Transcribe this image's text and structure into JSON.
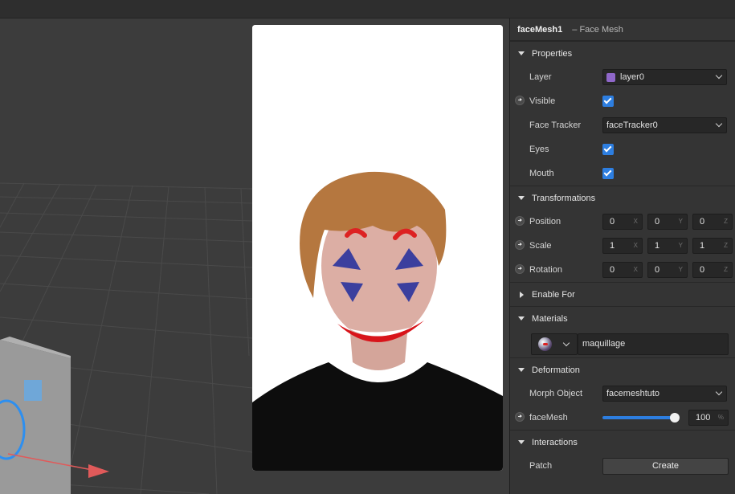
{
  "inspector": {
    "object_name": "faceMesh1",
    "object_type": "– Face Mesh",
    "sections": {
      "properties": "Properties",
      "transformations": "Transformations",
      "enable_for": "Enable For",
      "materials": "Materials",
      "deformation": "Deformation",
      "interactions": "Interactions"
    },
    "properties": {
      "layer_label": "Layer",
      "layer_value": "layer0",
      "layer_color": "#8f67c9",
      "visible_label": "Visible",
      "visible_checked": true,
      "face_tracker_label": "Face Tracker",
      "face_tracker_value": "faceTracker0",
      "eyes_label": "Eyes",
      "eyes_checked": true,
      "mouth_label": "Mouth",
      "mouth_checked": true
    },
    "transformations": {
      "position_label": "Position",
      "position": [
        "0",
        "0",
        "0"
      ],
      "scale_label": "Scale",
      "scale": [
        "1",
        "1",
        "1"
      ],
      "rotation_label": "Rotation",
      "rotation": [
        "0",
        "0",
        "0"
      ],
      "axes": [
        "X",
        "Y",
        "Z"
      ]
    },
    "materials": {
      "material_name": "maquillage",
      "material_icon": "material-sphere-icon"
    },
    "deformation": {
      "morph_object_label": "Morph Object",
      "morph_object_value": "facemeshtuto",
      "facemesh_label": "faceMesh",
      "facemesh_value": "100",
      "facemesh_fraction": 1.0,
      "unit": "%"
    },
    "interactions": {
      "patch_label": "Patch",
      "create_label": "Create"
    }
  },
  "colors": {
    "accent": "#2d7ee0",
    "panel_bg": "#343434",
    "viewport_bg": "#3c3c3c"
  }
}
